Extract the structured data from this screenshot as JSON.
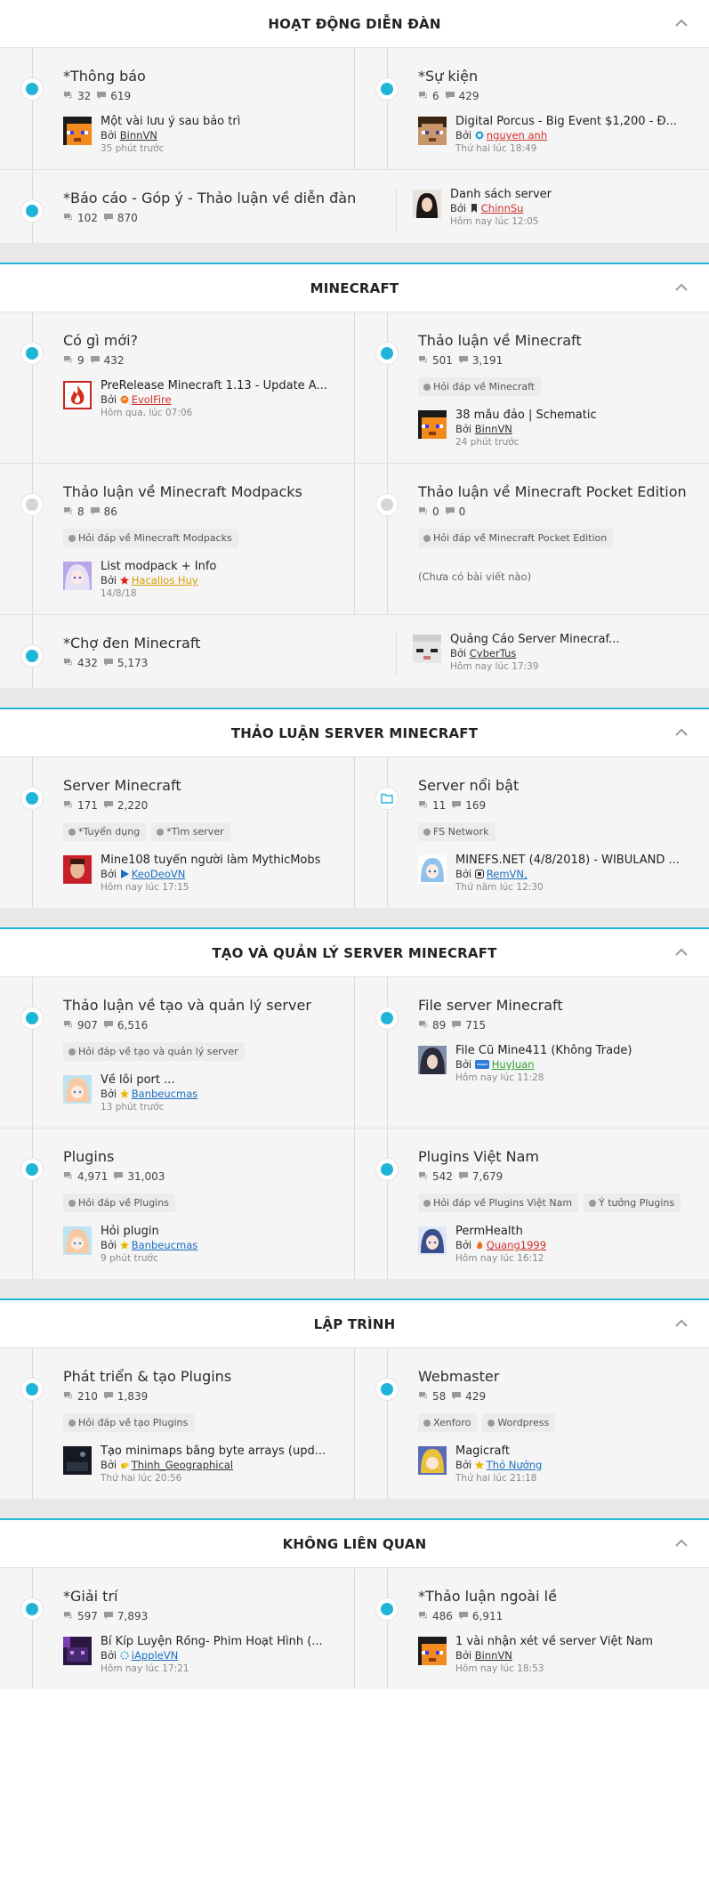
{
  "sections": [
    {
      "title": "HOẠT ĐỘNG DIỄN ĐÀN",
      "rows": [
        {
          "type": "pair",
          "cells": [
            {
              "name": "*Thông báo",
              "threads": "32",
              "posts": "619",
              "dot": "new",
              "tags": [],
              "last": {
                "title": "Một vài lưu ý sau bảo trì",
                "by": "Bởi",
                "user": "BinnVN",
                "user_color": "#333333",
                "badge": "",
                "time": "35 phút trước",
                "avatar": "skin-orange"
              }
            },
            {
              "name": "*Sự kiện",
              "threads": "6",
              "posts": "429",
              "dot": "new",
              "tags": [],
              "last": {
                "title": "Digital Porcus - Big Event $1,200 - Đ...",
                "by": "Bởi",
                "user": "nguyen anh",
                "user_color": "#d0312d",
                "badge": "circle-blue",
                "time": "Thứ hai lúc 18:49",
                "avatar": "skin-steve"
              }
            }
          ]
        },
        {
          "type": "wide",
          "cell": {
            "name": "*Báo cáo - Góp ý - Thảo luận về diễn đàn",
            "threads": "102",
            "posts": "870",
            "dot": "new",
            "tags": []
          },
          "last": {
            "title": "Danh sách server",
            "by": "Bởi",
            "user": "ChinnSu",
            "user_color": "#d0312d",
            "badge": "bookmark",
            "time": "Hôm nay lúc 12:05",
            "avatar": "photo-girl"
          }
        }
      ]
    },
    {
      "title": "MINECRAFT",
      "rows": [
        {
          "type": "pair",
          "cells": [
            {
              "name": "Có gì mới?",
              "threads": "9",
              "posts": "432",
              "dot": "new",
              "tags": [],
              "last": {
                "title": "PreRelease Minecraft 1.13 - Update A...",
                "by": "Bởi",
                "user": "EvolFire",
                "user_color": "#d0312d",
                "badge": "circle-orange",
                "time": "Hôm qua, lúc 07:06",
                "avatar": "fire-logo"
              }
            },
            {
              "name": "Thảo luận về Minecraft",
              "threads": "501",
              "posts": "3,191",
              "dot": "new",
              "tags": [
                "Hỏi đáp về Minecraft"
              ],
              "last": {
                "title": "38 mẫu đảo | Schematic",
                "by": "Bởi",
                "user": "BinnVN",
                "user_color": "#333333",
                "badge": "",
                "time": "24 phút trước",
                "avatar": "skin-orange"
              }
            }
          ]
        },
        {
          "type": "pair",
          "cells": [
            {
              "name": "Thảo luận về Minecraft Modpacks",
              "threads": "8",
              "posts": "86",
              "dot": "read",
              "tags": [
                "Hỏi đáp về Minecraft Modpacks"
              ],
              "last": {
                "title": "List modpack + Info",
                "by": "Bởi",
                "user": "Hacalios Huy",
                "user_color": "#d4a200",
                "badge": "star-red",
                "time": "14/8/18",
                "avatar": "anime-purple"
              }
            },
            {
              "name": "Thảo luận về Minecraft Pocket Edition",
              "threads": "0",
              "posts": "0",
              "dot": "read",
              "tags": [
                "Hỏi đáp về Minecraft Pocket Edition"
              ],
              "last": null,
              "nopost": "(Chưa có bài viết nào)"
            }
          ]
        },
        {
          "type": "wide",
          "cell": {
            "name": "*Chợ đen Minecraft",
            "threads": "432",
            "posts": "5,173",
            "dot": "new",
            "tags": []
          },
          "last": {
            "title": "Quảng Cáo Server Minecraf...",
            "by": "Bởi",
            "user": "CyberTus",
            "user_color": "#333333",
            "badge": "",
            "time": "Hôm nay lúc 17:39",
            "avatar": "skin-white"
          }
        }
      ]
    },
    {
      "title": "THẢO LUẬN SERVER MINECRAFT",
      "rows": [
        {
          "type": "pair",
          "cells": [
            {
              "name": "Server Minecraft",
              "threads": "171",
              "posts": "2,220",
              "dot": "new",
              "tags": [
                "*Tuyển dụng",
                "*Tìm server"
              ],
              "last": {
                "title": "Mine108 tuyển người làm MythicMobs",
                "by": "Bởi",
                "user": "KeoDeoVN",
                "user_color": "#1a6fc2",
                "badge": "play-blue",
                "time": "Hôm nay lúc 17:15",
                "avatar": "photo-red"
              }
            },
            {
              "name": "Server nổi bật",
              "threads": "11",
              "posts": "169",
              "dot": "folder",
              "tags": [
                "FS Network"
              ],
              "last": {
                "title": "MINEFS.NET (4/8/2018) - WIBULAND ...",
                "by": "Bởi",
                "user": "RemVN,",
                "user_color": "#1a6fc2",
                "badge": "square-dark",
                "time": "Thứ năm lúc 12:30",
                "avatar": "anime-blue"
              }
            }
          ]
        }
      ]
    },
    {
      "title": "TẠO VÀ QUẢN LÝ SERVER MINECRAFT",
      "rows": [
        {
          "type": "pair",
          "cells": [
            {
              "name": "Thảo luận về tạo và quản lý server",
              "threads": "907",
              "posts": "6,516",
              "dot": "new",
              "tags": [
                "Hỏi đáp về tạo và quản lý server"
              ],
              "last": {
                "title": "Về lỗi port ...",
                "by": "Bởi",
                "user": "Banbeucmas",
                "user_color": "#1a6fc2",
                "badge": "star-gold",
                "time": "13 phút trước",
                "avatar": "anime-pink"
              }
            },
            {
              "name": "File server Minecraft",
              "threads": "89",
              "posts": "715",
              "dot": "new",
              "tags": [],
              "last": {
                "title": "File Cũ Mine411 (Không Trade)",
                "by": "Bởi",
                "user": "HuyJuan",
                "user_color": "#2e9e2e",
                "badge": "tag-blue",
                "time": "Hôm nay lúc 11:28",
                "avatar": "anime-dark"
              }
            }
          ]
        },
        {
          "type": "pair",
          "cells": [
            {
              "name": "Plugins",
              "threads": "4,971",
              "posts": "31,003",
              "dot": "new",
              "tags": [
                "Hỏi đáp về Plugins"
              ],
              "last": {
                "title": "Hỏi plugin",
                "by": "Bởi",
                "user": "Banbeucmas",
                "user_color": "#1a6fc2",
                "badge": "star-gold",
                "time": "9 phút trước",
                "avatar": "anime-pink"
              }
            },
            {
              "name": "Plugins Việt Nam",
              "threads": "542",
              "posts": "7,679",
              "dot": "new",
              "tags": [
                "Hỏi đáp về Plugins Việt Nam",
                "Ý tưởng Plugins"
              ],
              "last": {
                "title": "PermHealth",
                "by": "Bởi",
                "user": "Quang1999",
                "user_color": "#d0312d",
                "badge": "flame",
                "time": "Hôm nay lúc 16:12",
                "avatar": "anime-blue2"
              }
            }
          ]
        }
      ]
    },
    {
      "title": "LẬP TRÌNH",
      "rows": [
        {
          "type": "pair",
          "cells": [
            {
              "name": "Phát triển & tạo Plugins",
              "threads": "210",
              "posts": "1,839",
              "dot": "new",
              "tags": [
                "Hỏi đáp về tạo Plugins"
              ],
              "last": {
                "title": "Tạo minimaps bằng byte arrays (upd...",
                "by": "Bởi",
                "user": "Thinh_Geographical",
                "user_color": "#333333",
                "badge": "cloud-gold",
                "time": "Thứ hai lúc 20:56",
                "avatar": "dark-scene"
              }
            },
            {
              "name": "Webmaster",
              "threads": "58",
              "posts": "429",
              "dot": "new",
              "tags": [
                "Xenforo",
                "Wordpress"
              ],
              "last": {
                "title": "Magicraft",
                "by": "Bởi",
                "user": "Thỏ Nướng",
                "user_color": "#1a6fc2",
                "badge": "star-gold",
                "time": "Thứ hai lúc 21:18",
                "avatar": "anime-yellow"
              }
            }
          ]
        }
      ]
    },
    {
      "title": "KHÔNG LIÊN QUAN",
      "rows": [
        {
          "type": "pair",
          "cells": [
            {
              "name": "*Giải trí",
              "threads": "597",
              "posts": "7,893",
              "dot": "new",
              "tags": [],
              "last": {
                "title": "Bí Kíp Luyện Rồng- Phim Hoạt Hình (...",
                "by": "Bởi",
                "user": "iAppleVN",
                "user_color": "#1a6fc2",
                "badge": "spin",
                "time": "Hôm nay lúc 17:21",
                "avatar": "skin-purple"
              }
            },
            {
              "name": "*Thảo luận ngoài lề",
              "threads": "486",
              "posts": "6,911",
              "dot": "new",
              "tags": [],
              "last": {
                "title": "1 vài nhận xét về server Việt Nam",
                "by": "Bởi",
                "user": "BinnVN",
                "user_color": "#333333",
                "badge": "",
                "time": "Hôm nay lúc 18:53",
                "avatar": "skin-orange"
              }
            }
          ]
        }
      ]
    }
  ],
  "colors": {
    "accent": "#1fb5d6",
    "read_dot": "#d6d6d6",
    "section_gap": "#e8e8e8"
  }
}
